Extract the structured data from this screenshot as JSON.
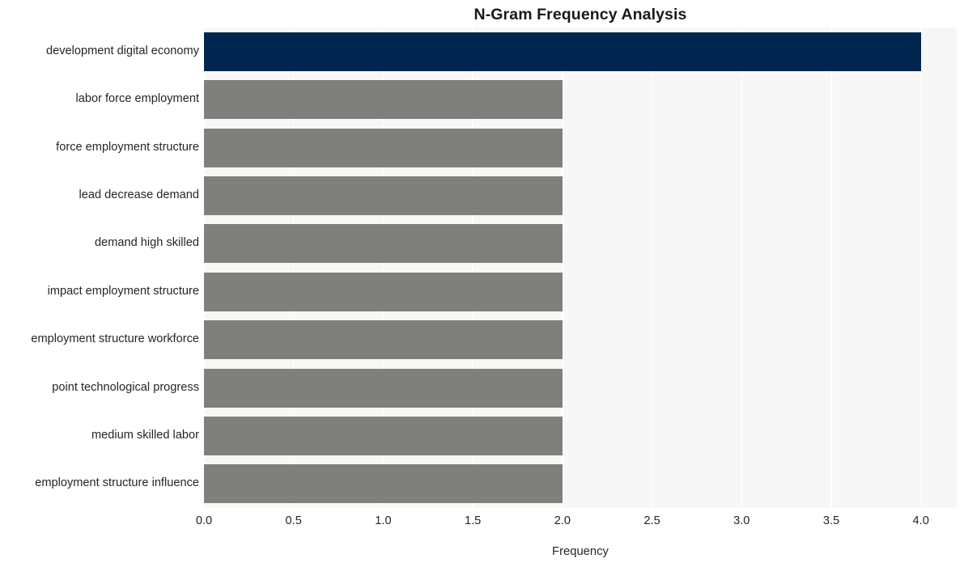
{
  "chart_data": {
    "type": "bar",
    "orientation": "horizontal",
    "title": "N-Gram Frequency Analysis",
    "xlabel": "Frequency",
    "ylabel": "",
    "categories": [
      "development digital economy",
      "labor force employment",
      "force employment structure",
      "lead decrease demand",
      "demand high skilled",
      "impact employment structure",
      "employment structure workforce",
      "point technological progress",
      "medium skilled labor",
      "employment structure influence"
    ],
    "values": [
      4,
      2,
      2,
      2,
      2,
      2,
      2,
      2,
      2,
      2
    ],
    "bar_colors": [
      "#00264f",
      "#7f7f7c",
      "#7f7f7c",
      "#7f7f7c",
      "#7f7f7c",
      "#7f7f7c",
      "#7f7f7c",
      "#7f7f7c",
      "#7f7f7c",
      "#7f7f7c"
    ],
    "xlim": [
      0.0,
      4.2
    ],
    "x_ticks": [
      0.0,
      0.5,
      1.0,
      1.5,
      2.0,
      2.5,
      3.0,
      3.5,
      4.0
    ],
    "x_tick_labels": [
      "0.0",
      "0.5",
      "1.0",
      "1.5",
      "2.0",
      "2.5",
      "3.0",
      "3.5",
      "4.0"
    ],
    "grid": true,
    "grid_axis": "x",
    "grid_color": "#ffffff",
    "legend": false,
    "legend_position": "none",
    "plot_background": "#f7f7f7",
    "figure_background": "#ffffff",
    "highlight_color": "#00264f",
    "default_bar_color": "#7f7f7c",
    "text_color": "#262626"
  }
}
